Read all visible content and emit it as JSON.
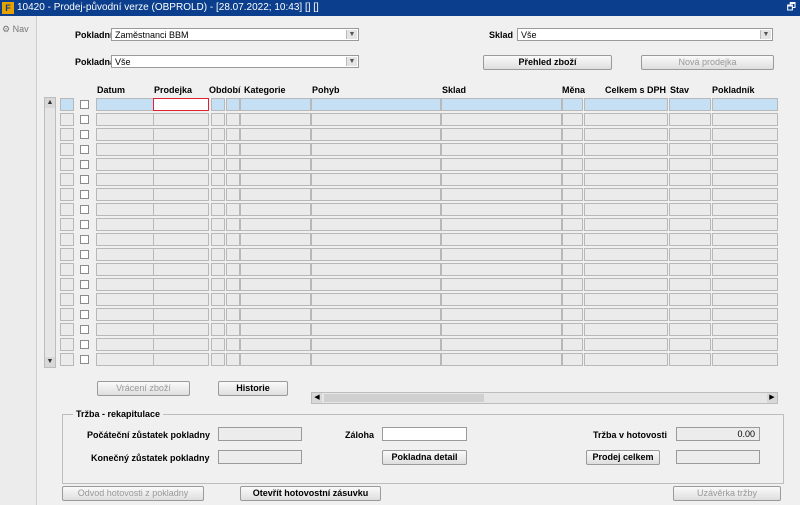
{
  "window": {
    "title": "10420 - Prodej-původní verze (OBPROLD) - [28.07.2022; 10:43]  []  []",
    "logo": "F"
  },
  "nav": {
    "label": "Nav"
  },
  "filters": {
    "pokladnik_label": "Pokladník",
    "pokladnik_value": "Zaměstnanci BBM",
    "sklad_label": "Sklad",
    "sklad_value": "Vše",
    "pokladna_label": "Pokladna",
    "pokladna_value": "Vše"
  },
  "buttons": {
    "prehled": "Přehled zboží",
    "nova": "Nová prodejka",
    "vraceni": "Vrácení zboží",
    "historie": "Historie",
    "pokladna_detail": "Pokladna detail",
    "prodej_celkem": "Prodej celkem",
    "odvod": "Odvod hotovosti z pokladny",
    "otevrit": "Otevřít hotovostní zásuvku",
    "uzaverka": "Uzávěrka tržby"
  },
  "columns": [
    "Datum",
    "Prodejka",
    "Období",
    "Kategorie",
    "Pohyb",
    "Sklad",
    "Měna",
    "Celkem s DPH",
    "Stav",
    "Pokladník"
  ],
  "summary": {
    "title": "Tržba - rekapitulace",
    "pocatecni_label": "Počáteční zůstatek pokladny",
    "konecny_label": "Konečný zůstatek pokladny",
    "zaloha_label": "Záloha",
    "trzba_label": "Tržba v hotovosti",
    "trzba_value": "0.00"
  }
}
